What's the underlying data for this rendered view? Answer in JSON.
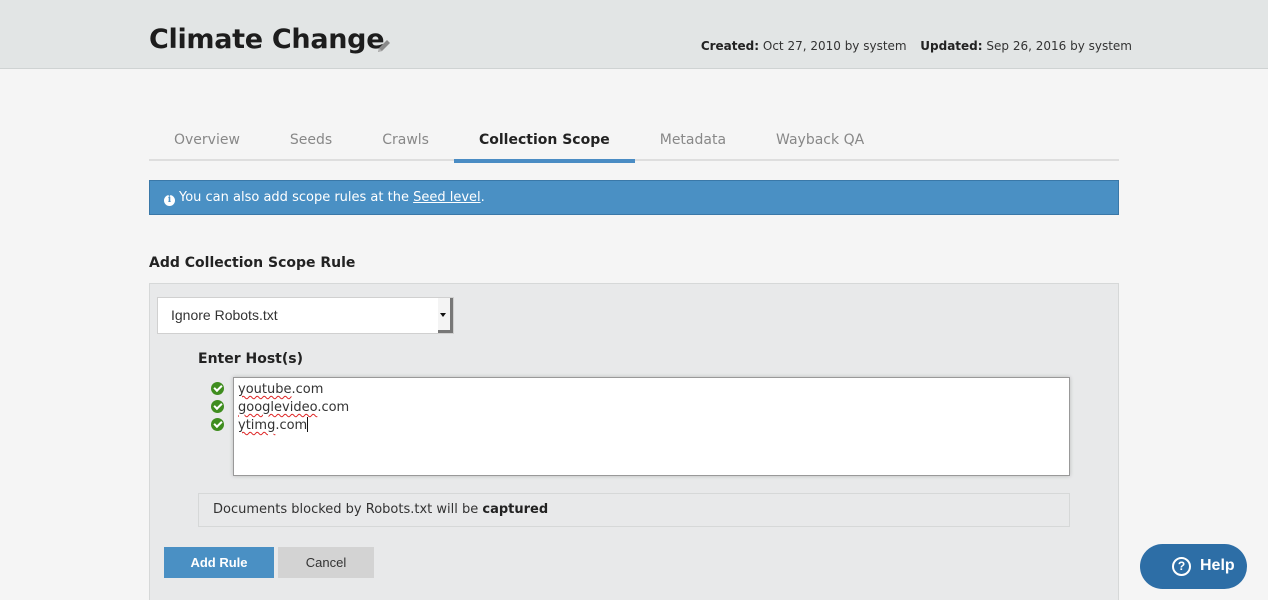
{
  "header": {
    "title": "Climate Change",
    "edit_icon": "pencil-icon",
    "created_label": "Created:",
    "created_value": "Oct 27, 2010 by system",
    "updated_label": "Updated:",
    "updated_value": "Sep 26, 2016 by system"
  },
  "tabs": [
    {
      "label": "Overview",
      "active": false
    },
    {
      "label": "Seeds",
      "active": false
    },
    {
      "label": "Crawls",
      "active": false
    },
    {
      "label": "Collection Scope",
      "active": true
    },
    {
      "label": "Metadata",
      "active": false
    },
    {
      "label": "Wayback QA",
      "active": false
    }
  ],
  "alert": {
    "icon": "info-icon",
    "text_before": "You can also add scope rules at the ",
    "link_text": "Seed level",
    "text_after": "."
  },
  "form": {
    "section_title": "Add Collection Scope Rule",
    "rule_type_selected": "Ignore Robots.txt",
    "hosts_label": "Enter Host(s)",
    "hosts": [
      "youtube.com",
      "googlevideo.com",
      "ytimg.com"
    ],
    "host_spellcheck_words": [
      "youtube",
      "googlevideo",
      "ytimg"
    ],
    "host_suffix": ".com",
    "note_text": "Documents blocked by Robots.txt will be ",
    "note_emphasis": "captured",
    "add_button": "Add Rule",
    "cancel_button": "Cancel"
  },
  "help": {
    "icon": "question-circle-icon",
    "label": "Help"
  },
  "colors": {
    "accent": "#4a90c4",
    "help_button": "#2d6ea6",
    "valid_check": "#3f8d1f"
  }
}
